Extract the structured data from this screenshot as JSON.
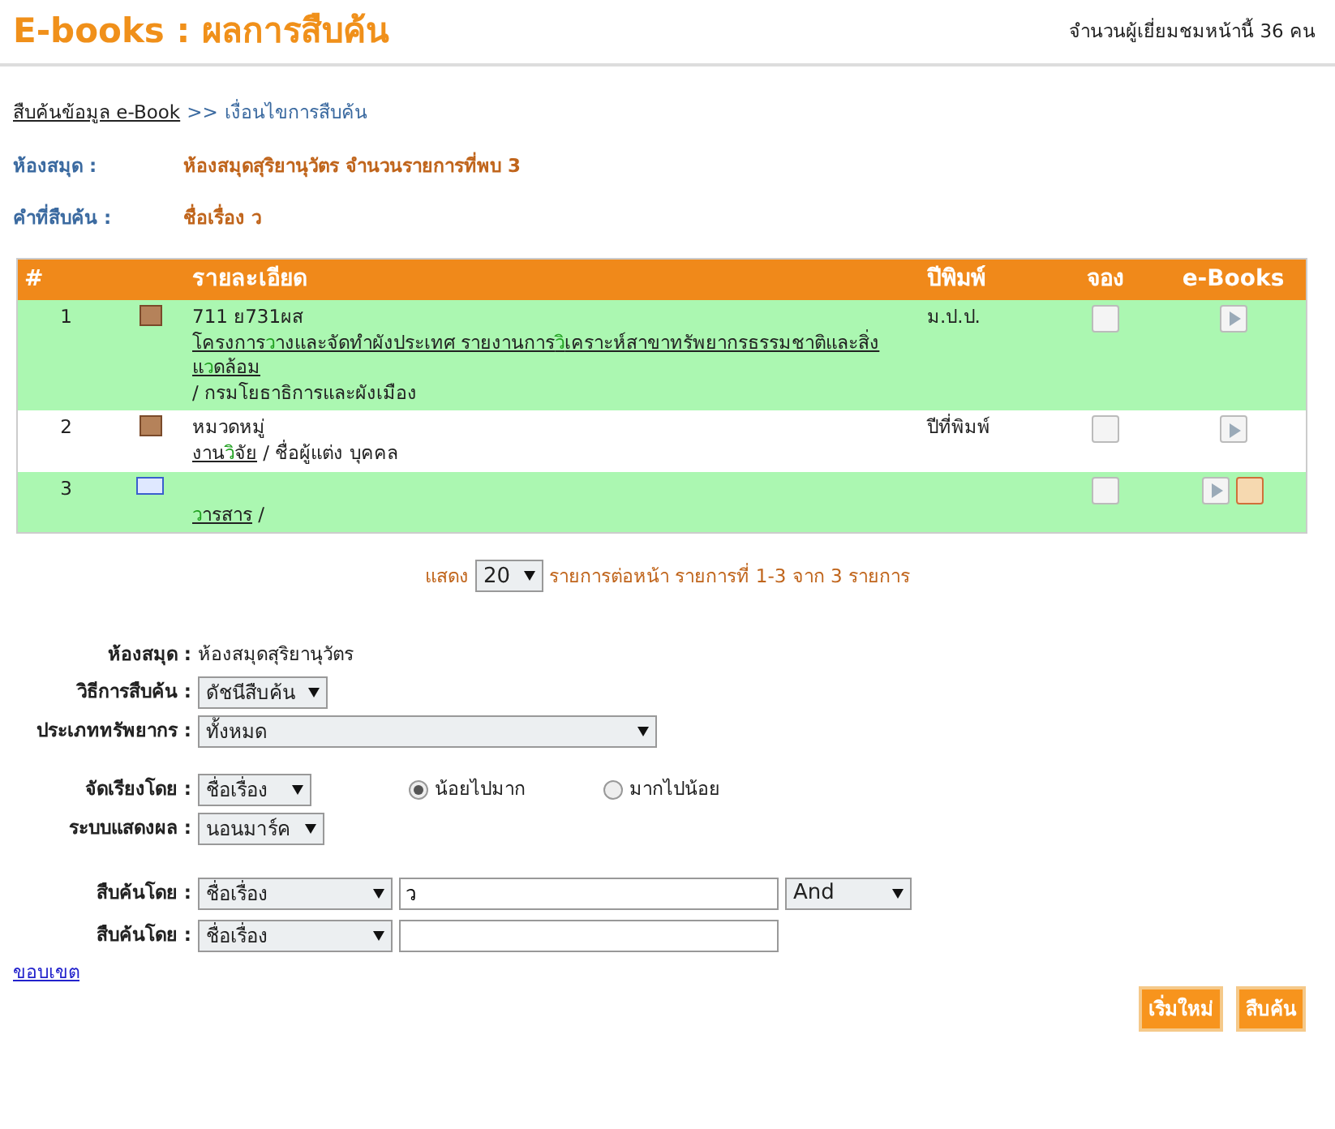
{
  "header": {
    "title": "E-books : ผลการสืบค้น",
    "visitors": "จำนวนผู้เยี่ยมชมหน้านี้ 36 คน"
  },
  "breadcrumb": {
    "link": "สืบค้นข้อมูล e-Book",
    "separator": ">>",
    "current": "เงื่อนไขการสืบค้น"
  },
  "info": [
    {
      "label": "ห้องสมุด :",
      "value": "ห้องสมุดสุริยานุวัตร จำนวนรายการที่พบ 3"
    },
    {
      "label": "คำที่สืบค้น :",
      "value": "ชื่อเรื่อง ว"
    }
  ],
  "table": {
    "columns": [
      "#",
      "",
      "รายละเอียด",
      "ปีพิมพ์",
      "จอง",
      "e-Books"
    ],
    "rows": [
      {
        "number": "1",
        "kind": "book",
        "line_1": "711 ย731ผส",
        "title": "โครงการ**ว**างและจัดทำผังประเทศ รายงานการ**วิ**เคราะห์สาขาทรัพยากรธรรมชาติและสิ่งแ**ว**ดล้อม",
        "author": " / กรมโยธาธิการและผังเมือง",
        "year": "ม.ป.ป.",
        "ebooks": [
          {
            "kind": "play"
          }
        ]
      },
      {
        "number": "2",
        "kind": "book",
        "line_1": "หมวดหมู่",
        "title": "งาน**วิ**จัย",
        "author": " / ชื่อผู้แต่ง บุคคล",
        "year": "ปีที่พิมพ์",
        "ebooks": [
          {
            "kind": "play"
          }
        ]
      },
      {
        "number": "3",
        "kind": "journal",
        "line_1": "",
        "title": "**ว**ารสาร",
        "author": " /",
        "year": "",
        "ebooks": [
          {
            "kind": "play"
          },
          {
            "kind": "document"
          }
        ]
      }
    ]
  },
  "paging": {
    "prefix": "แสดง",
    "per_page": "20",
    "suffix": "รายการต่อหน้า รายการที่ 1-3 จาก 3 รายการ"
  },
  "form": {
    "library": {
      "label": "ห้องสมุด :",
      "value": "ห้องสมุดสุริยานุวัตร"
    },
    "method": {
      "label": "วิธีการสืบค้น :",
      "value": "ดัชนีสืบค้น"
    },
    "resource_type": {
      "label": "ประเภททรัพยากร :",
      "value": "ทั้งหมด"
    },
    "sort": {
      "label": "จัดเรียงโดย :",
      "value": "ชื่อเรื่อง",
      "options": [
        {
          "label": "น้อยไปมาก",
          "selected": true
        },
        {
          "label": "มากไปน้อย",
          "selected": false
        }
      ]
    },
    "display": {
      "label": "ระบบแสดงผล :",
      "value": "นอนมาร์ค"
    },
    "search_rows": [
      {
        "label": "สืบค้นโดย :",
        "field": "ชื่อเรื่อง",
        "value": "ว",
        "operator": "And"
      },
      {
        "label": "สืบค้นโดย :",
        "field": "ชื่อเรื่อง",
        "value": "",
        "operator": ""
      }
    ],
    "scope_link": "ขอบเขต",
    "buttons": [
      "เริ่มใหม่",
      "สืบค้น"
    ]
  }
}
